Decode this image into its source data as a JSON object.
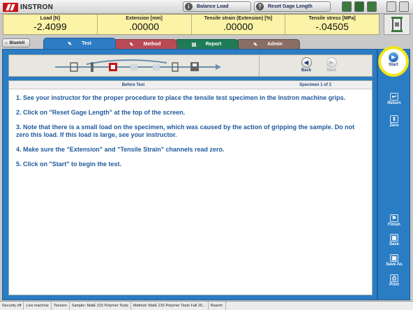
{
  "app": {
    "name": "INSTRON"
  },
  "topbar": {
    "balance_load_label": "Balance Load",
    "reset_gage_label": "Reset Gage Length",
    "balance_icon": "i",
    "reset_icon": "?"
  },
  "readouts": [
    {
      "label": "Load [N]",
      "value": "-2.4099"
    },
    {
      "label": "Extension [mm]",
      "value": ".00000"
    },
    {
      "label": "Tensile strain (Extension) [%]",
      "value": ".00000"
    },
    {
      "label": "Tensile stress [MPa]",
      "value": "-.04505"
    }
  ],
  "nav": {
    "bluehill_label": "Bluehill"
  },
  "tabs": {
    "test": "Test",
    "method": "Method",
    "report": "Report",
    "admin": "Admin"
  },
  "wizard": {
    "back_label": "Back",
    "next_label": "Next"
  },
  "content": {
    "header_left": "Before Test",
    "header_right": "Specimen 1 of 3",
    "instructions": [
      "1. See your instructor for the proper procedure to place the tensile test specimen in the Instron machine grips.",
      "2. Click on \"Reset Gage Length\" at the top of the screen.",
      "3. Note that there is a small load on the specimen, which was caused by the action of gripping the sample. Do not zero this load. If this load is large, see your instructor.",
      "4. Make sure the \"Extension\" and \"Tensile Strain\" channels read zero.",
      "5. Click on \"Start\" to begin the test."
    ]
  },
  "rightbar": {
    "start": "Start",
    "return": "Return",
    "zero": "Zero",
    "finish": "Finish",
    "save": "Save",
    "save_as": "Save As",
    "print": "Print"
  },
  "status": [
    "Security off",
    "Live machine",
    "Tension",
    "Sample: MatE 215 Polymer Tests",
    "Method: MatE 215 Polymer Tests Fall 20...",
    "Report:"
  ],
  "colors": {
    "accent_blue": "#2a7cc3",
    "readout_yellow": "#fbf3a6",
    "highlight_ring": "#f2e417",
    "logo_red": "#c4161c"
  }
}
